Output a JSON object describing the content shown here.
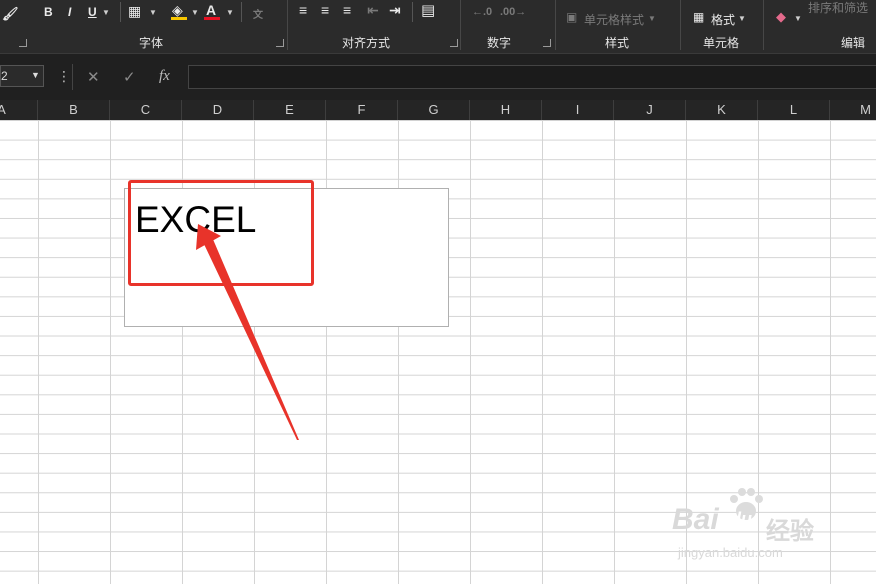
{
  "ribbon": {
    "groups": [
      {
        "label": "字体"
      },
      {
        "label": "对齐方式"
      },
      {
        "label": "数字"
      },
      {
        "label": "样式"
      },
      {
        "label": "单元格"
      },
      {
        "label": "编辑"
      }
    ],
    "font": {
      "bold": "B",
      "italic": "I",
      "underline": "U",
      "font_color_letter": "A",
      "phonetic": "文"
    },
    "styles": {
      "cell_styles": "单元格样式"
    },
    "cells": {
      "format": "格式"
    },
    "editing": {
      "sort_filter": "排序和筛选"
    }
  },
  "formula_bar": {
    "name_box_value": "2",
    "cancel_glyph": "✕",
    "enter_glyph": "✓",
    "fx_label": "fx",
    "formula_value": ""
  },
  "columns": [
    "A",
    "B",
    "C",
    "D",
    "E",
    "F",
    "G",
    "H",
    "I",
    "J",
    "K",
    "L",
    "M"
  ],
  "textbox": {
    "text": "EXCEL"
  },
  "watermark": {
    "logo": "Bai",
    "paw": "du",
    "cn": "经验",
    "url": "jingyan.baidu.com"
  },
  "colors": {
    "ribbon_bg": "#2b2b2b",
    "annotation_red": "#e8332a",
    "font_color_bar": "#e81123",
    "fill_color_bar": "#f7c600"
  }
}
